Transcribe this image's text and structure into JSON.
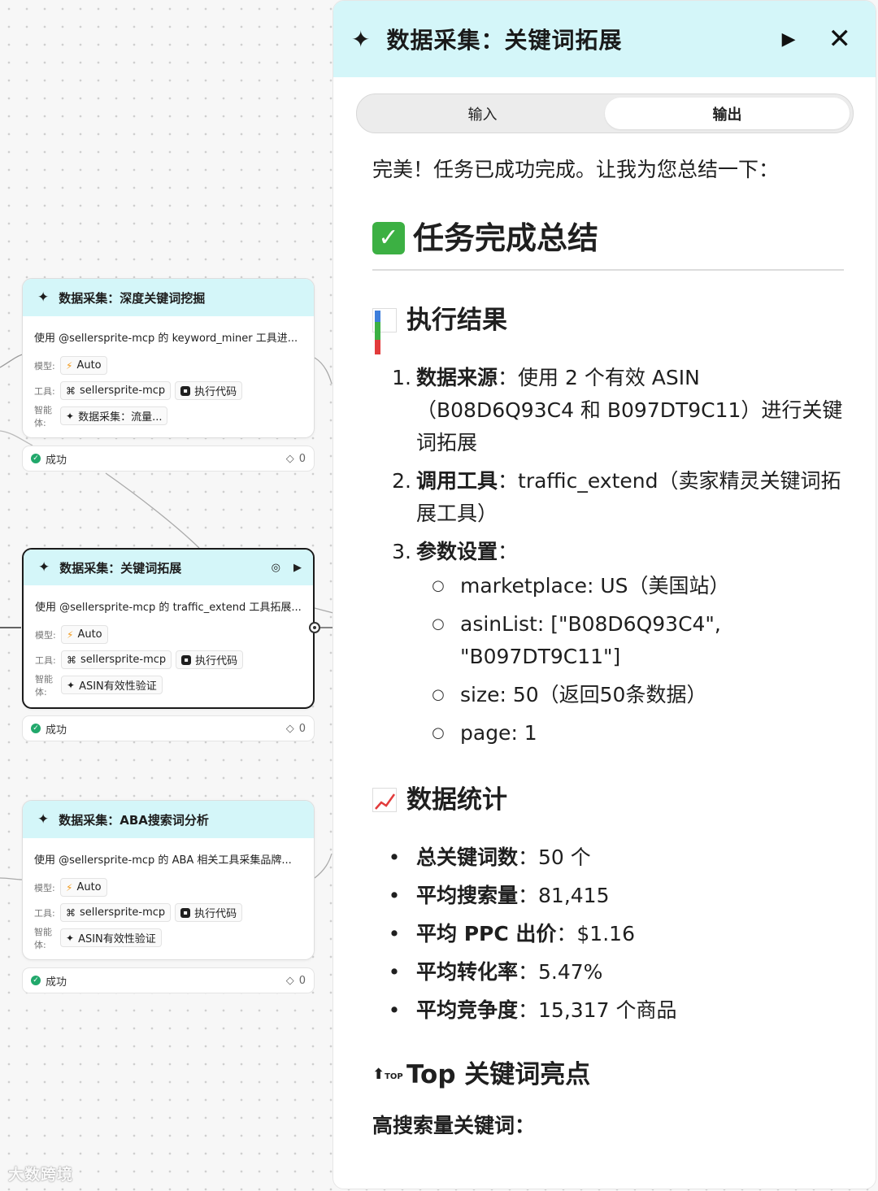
{
  "nodes": [
    {
      "title": "数据采集：深度关键词挖掘",
      "desc": "使用 @sellersprite-mcp 的 keyword_miner 工具进...",
      "model_label": "模型:",
      "model": "Auto",
      "tools_label": "工具:",
      "tool1": "sellersprite-mcp",
      "tool2": "执行代码",
      "agent_label": "智能体:",
      "agent": "数据采集：流量...",
      "status": "成功",
      "count": "0"
    },
    {
      "title": "数据采集：关键词拓展",
      "desc": "使用 @sellersprite-mcp 的 traffic_extend 工具拓展...",
      "model_label": "模型:",
      "model": "Auto",
      "tools_label": "工具:",
      "tool1": "sellersprite-mcp",
      "tool2": "执行代码",
      "agent_label": "智能体:",
      "agent": "ASIN有效性验证",
      "status": "成功",
      "count": "0"
    },
    {
      "title": "数据采集：ABA搜索词分析",
      "desc": "使用 @sellersprite-mcp 的 ABA 相关工具采集品牌...",
      "model_label": "模型:",
      "model": "Auto",
      "tools_label": "工具:",
      "tool1": "sellersprite-mcp",
      "tool2": "执行代码",
      "agent_label": "智能体:",
      "agent": "ASIN有效性验证",
      "status": "成功",
      "count": "0"
    }
  ],
  "watermark": "大数跨境",
  "panel": {
    "title": "数据采集：关键词拓展",
    "tabs": [
      "输入",
      "输出"
    ],
    "active_tab": "输出",
    "intro": "完美！任务已成功完成。让我为您总结一下：",
    "summary_heading": "任务完成总结",
    "results_heading": "执行结果",
    "steps": [
      {
        "num": "1.",
        "label": "数据来源",
        "text": "：使用 2 个有效 ASIN（B08D6Q93C4 和 B097DT9C11）进行关键词拓展"
      },
      {
        "num": "2.",
        "label": "调用工具",
        "text": "：traffic_extend（卖家精灵关键词拓展工具）"
      },
      {
        "num": "3.",
        "label": "参数设置",
        "text": "："
      }
    ],
    "params": [
      "marketplace: US（美国站）",
      "asinList: [\"B08D6Q93C4\", \"B097DT9C11\"]",
      "size: 50（返回50条数据）",
      "page: 1"
    ],
    "stats_heading": "数据统计",
    "stats": [
      {
        "label": "总关键词数",
        "value": "：50 个"
      },
      {
        "label": "平均搜索量",
        "value": "：81,415"
      },
      {
        "label": "平均 PPC 出价",
        "value": "：$1.16"
      },
      {
        "label": "平均转化率",
        "value": "：5.47%"
      },
      {
        "label": "平均竞争度",
        "value": "：15,317 个商品"
      }
    ],
    "top_heading": "Top 关键词亮点",
    "top_badge": "TOP",
    "high_search": "高搜索量关键词："
  },
  "colors": {
    "header_bg": "#d4f6f9",
    "success": "#21a86b",
    "check": "#3cb043",
    "accent_bolt": "#f29b1e"
  }
}
